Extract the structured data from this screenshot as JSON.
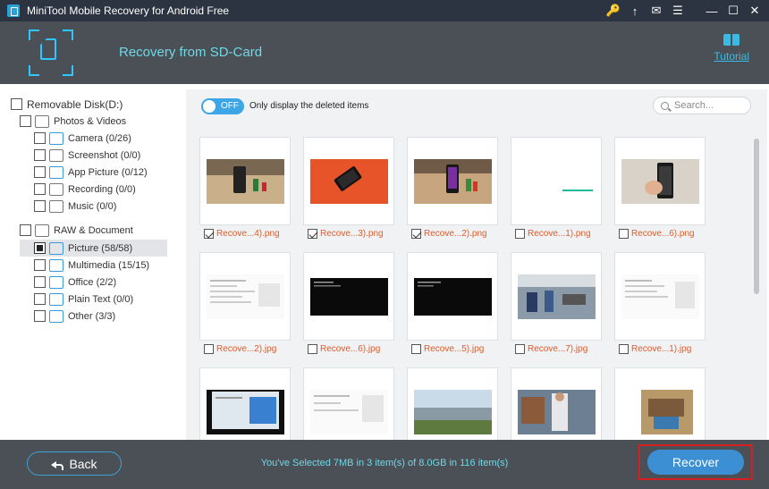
{
  "app": {
    "title": "MiniTool Mobile Recovery for Android Free",
    "title_icons": [
      "key-icon",
      "upgrade-arrow-icon",
      "mail-icon",
      "menu-icon",
      "minimize-icon",
      "maximize-icon",
      "close-icon"
    ]
  },
  "header": {
    "title": "Recovery from SD-Card",
    "tutorial_label": "Tutorial",
    "accent_color": "#3bbbe3"
  },
  "tree": {
    "root": "Removable Disk(D:)",
    "photos_group": "Photos & Videos",
    "photos_items": [
      {
        "label": "Camera (0/26)",
        "icon": "camera-icon"
      },
      {
        "label": "Screenshot (0/0)",
        "icon": "screenshot-icon"
      },
      {
        "label": "App Picture (0/12)",
        "icon": "app-picture-icon"
      },
      {
        "label": "Recording (0/0)",
        "icon": "recording-icon"
      },
      {
        "label": "Music (0/0)",
        "icon": "music-icon"
      }
    ],
    "raw_group": "RAW & Document",
    "raw_items": [
      {
        "label": "Picture (58/58)",
        "icon": "picture-icon",
        "state": "partial",
        "selected": true
      },
      {
        "label": "Multimedia (15/15)",
        "icon": "multimedia-icon"
      },
      {
        "label": "Office (2/2)",
        "icon": "office-icon"
      },
      {
        "label": "Plain Text (0/0)",
        "icon": "plain-text-icon"
      },
      {
        "label": "Other (3/3)",
        "icon": "other-icon"
      }
    ]
  },
  "filter": {
    "toggle_label": "OFF",
    "only_deleted_label": "Only display the deleted items"
  },
  "search": {
    "placeholder": "Search..."
  },
  "files": [
    {
      "name": "Recove...4).png",
      "checked": true
    },
    {
      "name": "Recove...3).png",
      "checked": true
    },
    {
      "name": "Recove...2).png",
      "checked": true
    },
    {
      "name": "Recove...1).png",
      "checked": false
    },
    {
      "name": "Recove...6).png",
      "checked": false
    },
    {
      "name": "Recove...2).jpg",
      "checked": false
    },
    {
      "name": "Recove...6).jpg",
      "checked": false
    },
    {
      "name": "Recove...5).jpg",
      "checked": false
    },
    {
      "name": "Recove...7).jpg",
      "checked": false
    },
    {
      "name": "Recove...1).jpg",
      "checked": false
    },
    {
      "name": "",
      "checked": false
    },
    {
      "name": "",
      "checked": false
    },
    {
      "name": "",
      "checked": false
    },
    {
      "name": "",
      "checked": false
    },
    {
      "name": "",
      "checked": false
    }
  ],
  "footer": {
    "back_label": "Back",
    "status": "You've Selected 7MB in 3 item(s) of 8.0GB in 116 item(s)",
    "recover_label": "Recover",
    "highlight_color": "#d71f20"
  }
}
